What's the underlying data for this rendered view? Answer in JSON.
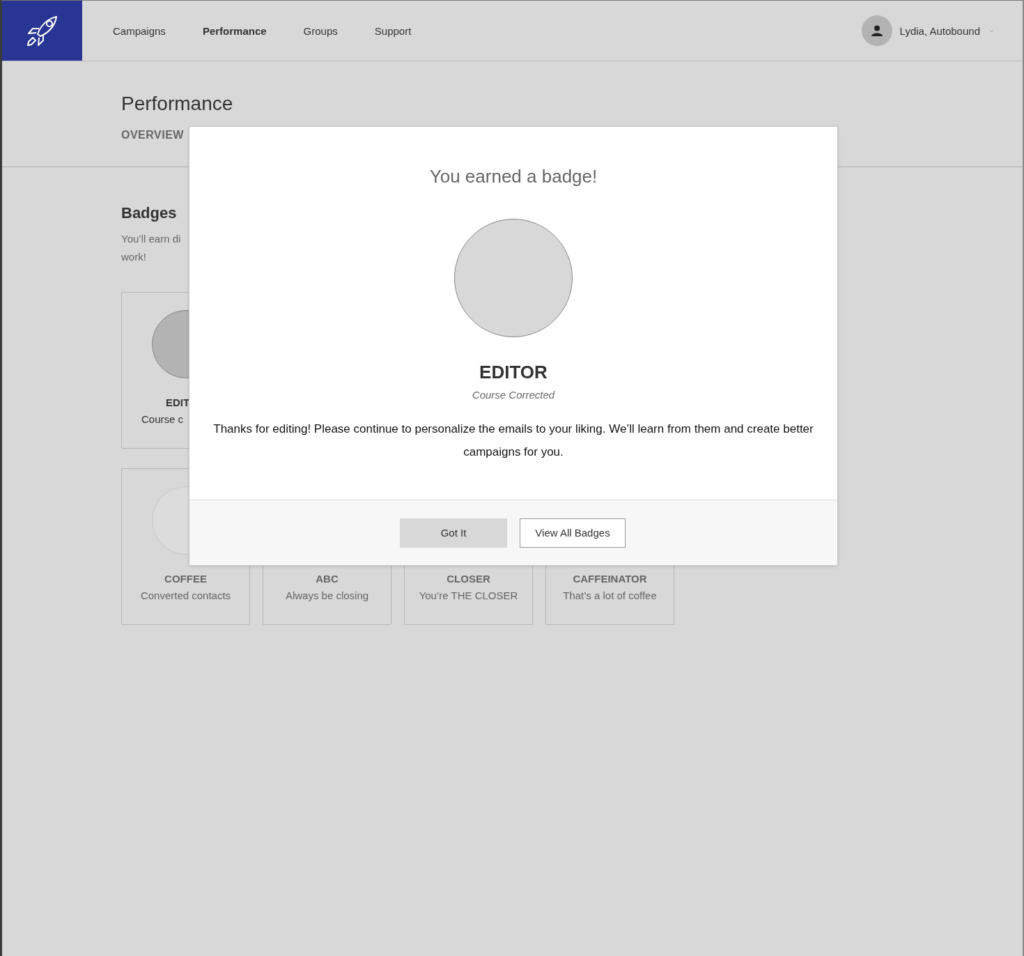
{
  "nav": {
    "items": [
      {
        "label": "Campaigns",
        "selected": false
      },
      {
        "label": "Performance",
        "selected": true
      },
      {
        "label": "Groups",
        "selected": false
      },
      {
        "label": "Support",
        "selected": false
      }
    ]
  },
  "user": {
    "name": "Lydia, Autobound"
  },
  "page": {
    "title": "Performance",
    "tabs": [
      "OVERVIEW"
    ]
  },
  "badges_section": {
    "heading": "Badges",
    "description_lines": [
      "You’ll earn di",
      "work!"
    ]
  },
  "badge_rows": [
    [
      {
        "name": "EDIT",
        "caption": "Course c",
        "earned": true
      }
    ],
    [
      {
        "name": "COFFEE",
        "caption": "Converted contacts",
        "earned": false
      },
      {
        "name": "ABC",
        "caption": "Always be closing"
      },
      {
        "name": "CLOSER",
        "caption": "You’re THE CLOSER"
      },
      {
        "name": "CAFFEINATOR",
        "caption": "That’s a lot of coffee"
      }
    ]
  ],
  "modal": {
    "title": "You earned a badge!",
    "badge_name": "EDITOR",
    "badge_caption": "Course Corrected",
    "message": "Thanks for editing! Please continue to personalize the emails to your liking. We’ll learn from them and create better campaigns for you.",
    "buttons": [
      {
        "label": "Got It",
        "kind": "filled"
      },
      {
        "label": "View All Badges",
        "kind": "outline"
      }
    ]
  }
}
